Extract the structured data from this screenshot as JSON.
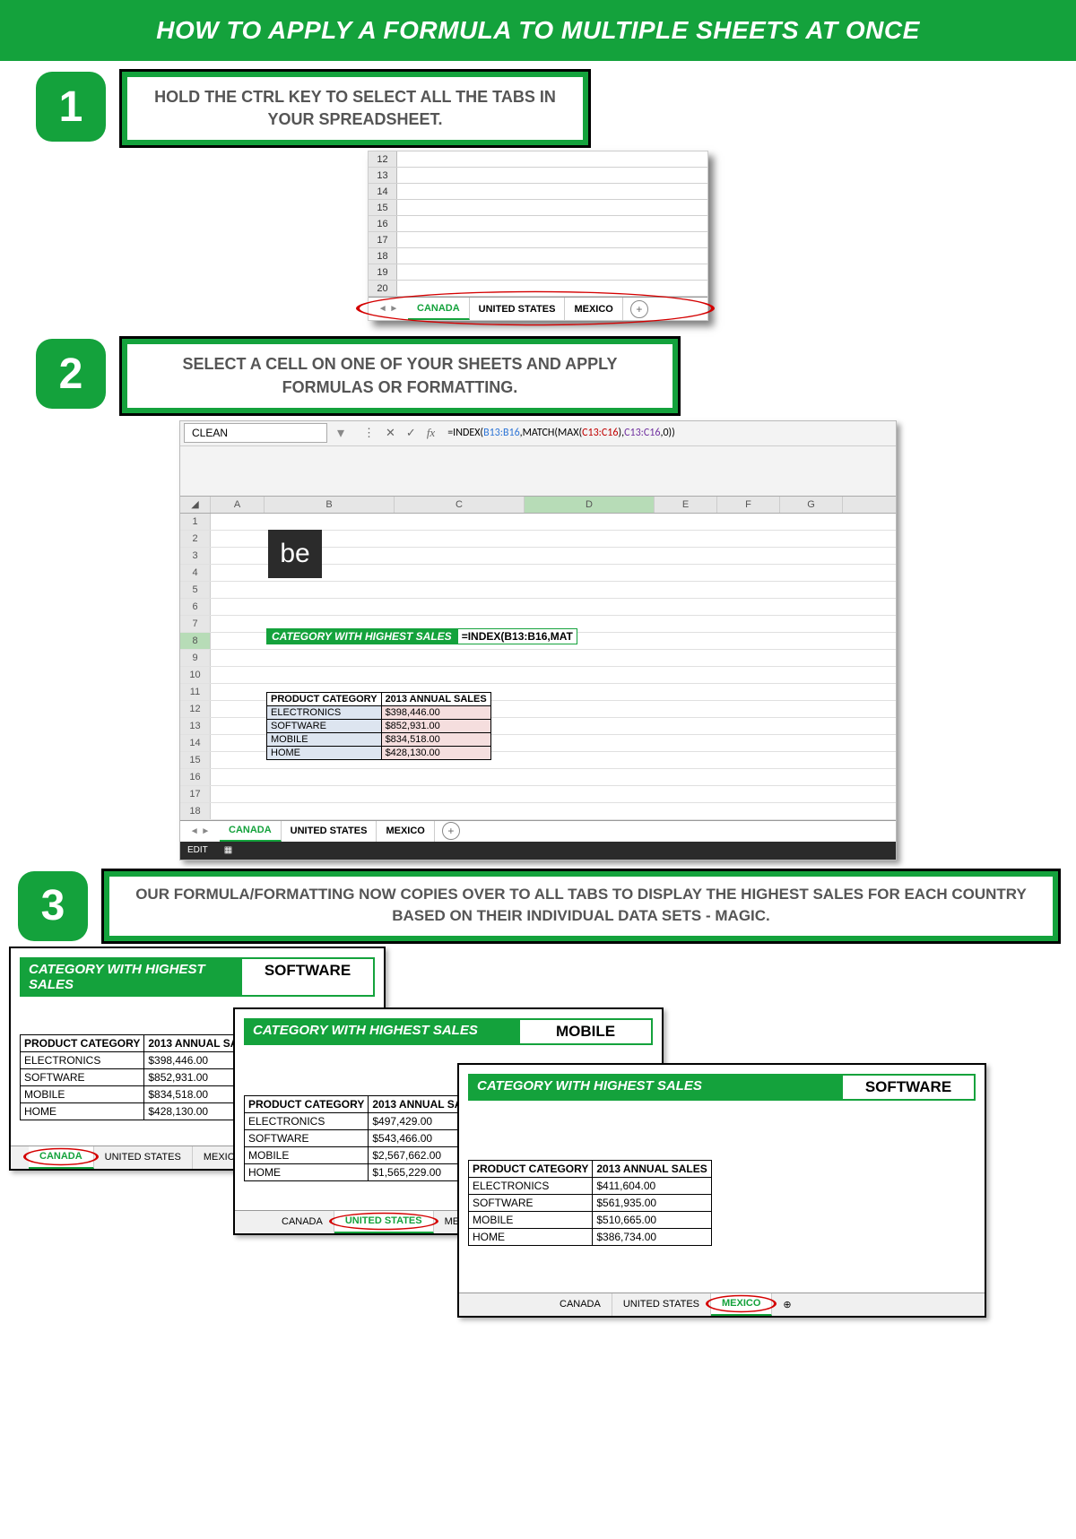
{
  "title": "HOW TO APPLY A FORMULA TO MULTIPLE SHEETS AT ONCE",
  "step1": {
    "num": "1",
    "text": "HOLD THE CTRL KEY TO SELECT ALL THE TABS IN YOUR SPREADSHEET.",
    "rows": [
      "12",
      "13",
      "14",
      "15",
      "16",
      "17",
      "18",
      "19",
      "20"
    ],
    "tabs": {
      "t1": "CANADA",
      "t2": "UNITED STATES",
      "t3": "MEXICO"
    }
  },
  "step2": {
    "num": "2",
    "text": "SELECT A CELL ON ONE OF YOUR SHEETS AND APPLY FORMULAS OR FORMATTING.",
    "namebox": "CLEAN",
    "formula_plain": "=INDEX(B13:B16,MATCH(MAX(C13:C16),C13:C16,0))",
    "formula_parts": {
      "p1": "=INDEX(",
      "r1": "B13:B16",
      "p2": ",MATCH(MAX(",
      "r2": "C13:C16",
      "p3": "),",
      "r3": "C13:C16",
      "p4": ",",
      "n": "0",
      "p5": "))"
    },
    "cols": [
      "A",
      "B",
      "C",
      "D",
      "E",
      "F",
      "G"
    ],
    "rows": [
      "1",
      "2",
      "3",
      "4",
      "5",
      "6",
      "7",
      "8",
      "9",
      "10",
      "11",
      "12",
      "13",
      "14",
      "15",
      "16",
      "17",
      "18"
    ],
    "be": "be",
    "label8": "CATEGORY WITH HIGHEST SALES",
    "cell8": "=INDEX(B13:B16,MAT",
    "table": {
      "h1": "PRODUCT CATEGORY",
      "h2": "2013 ANNUAL SALES",
      "r": [
        {
          "a": "ELECTRONICS",
          "b": "$398,446.00"
        },
        {
          "a": "SOFTWARE",
          "b": "$852,931.00"
        },
        {
          "a": "MOBILE",
          "b": "$834,518.00"
        },
        {
          "a": "HOME",
          "b": "$428,130.00"
        }
      ]
    },
    "tabs": {
      "t1": "CANADA",
      "t2": "UNITED STATES",
      "t3": "MEXICO"
    },
    "status": "EDIT"
  },
  "step3": {
    "num": "3",
    "text": "OUR FORMULA/FORMATTING NOW COPIES OVER TO ALL TABS TO DISPLAY THE HIGHEST SALES FOR EACH COUNTRY BASED ON THEIR INDIVIDUAL DATA SETS - MAGIC.",
    "labels": {
      "cat": "CATEGORY WITH HIGHEST SALES",
      "h1": "PRODUCT CATEGORY",
      "h2": "2013 ANNUAL SALES",
      "c": "CANADA",
      "u": "UNITED STATES",
      "m": "MEXICO"
    },
    "canada": {
      "result": "SOFTWARE",
      "rows": [
        {
          "a": "ELECTRONICS",
          "b": "$398,446.00"
        },
        {
          "a": "SOFTWARE",
          "b": "$852,931.00"
        },
        {
          "a": "MOBILE",
          "b": "$834,518.00"
        },
        {
          "a": "HOME",
          "b": "$428,130.00"
        }
      ]
    },
    "us": {
      "result": "MOBILE",
      "rows": [
        {
          "a": "ELECTRONICS",
          "b": "$497,429.00"
        },
        {
          "a": "SOFTWARE",
          "b": "$543,466.00"
        },
        {
          "a": "MOBILE",
          "b": "$2,567,662.00"
        },
        {
          "a": "HOME",
          "b": "$1,565,229.00"
        }
      ]
    },
    "mexico": {
      "result": "SOFTWARE",
      "rows": [
        {
          "a": "ELECTRONICS",
          "b": "$411,604.00"
        },
        {
          "a": "SOFTWARE",
          "b": "$561,935.00"
        },
        {
          "a": "MOBILE",
          "b": "$510,665.00"
        },
        {
          "a": "HOME",
          "b": "$386,734.00"
        }
      ]
    }
  }
}
